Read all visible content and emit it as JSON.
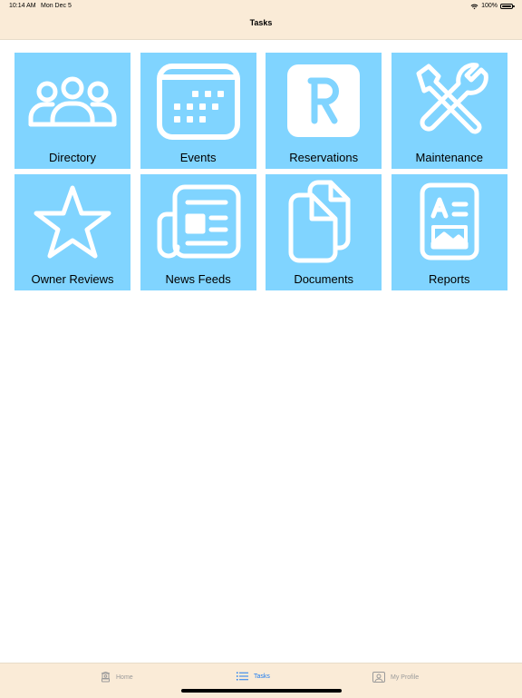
{
  "status_bar": {
    "time": "10:14 AM",
    "date": "Mon Dec 5",
    "battery": "100%",
    "icons": [
      "wifi-icon",
      "battery-icon"
    ]
  },
  "nav": {
    "title": "Tasks"
  },
  "tiles": [
    {
      "label": "Directory",
      "icon": "people-icon"
    },
    {
      "label": "Events",
      "icon": "calendar-icon"
    },
    {
      "label": "Reservations",
      "icon": "reservation-r-icon"
    },
    {
      "label": "Maintenance",
      "icon": "tools-icon"
    },
    {
      "label": "Owner Reviews",
      "icon": "star-icon"
    },
    {
      "label": "News Feeds",
      "icon": "newspaper-icon"
    },
    {
      "label": "Documents",
      "icon": "documents-icon"
    },
    {
      "label": "Reports",
      "icon": "report-icon"
    }
  ],
  "tab_bar": {
    "items": [
      {
        "label": "Home",
        "icon": "home-icon",
        "active": false
      },
      {
        "label": "Tasks",
        "icon": "list-icon",
        "active": true
      },
      {
        "label": "My Profile",
        "icon": "profile-icon",
        "active": false
      }
    ]
  },
  "colors": {
    "header_bg": "#faebd7",
    "tile_bg": "#80d4ff",
    "tab_active": "#1e7cf0",
    "tab_inactive": "#9a9a9a"
  }
}
